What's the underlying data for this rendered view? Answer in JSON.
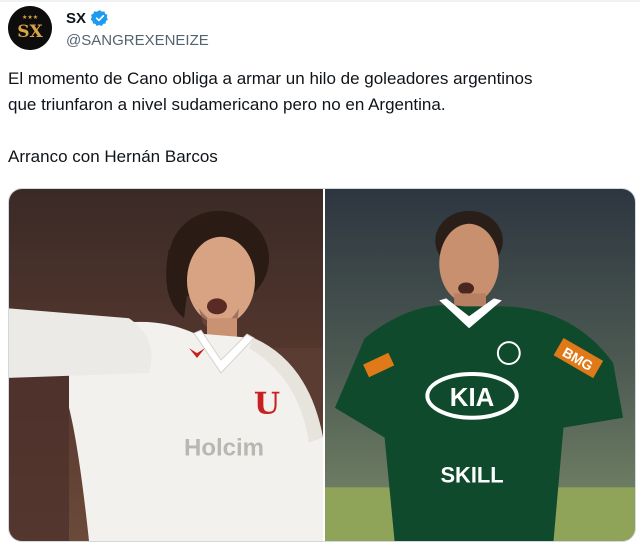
{
  "author": {
    "name": "SX",
    "handle": "@SANGREXENEIZE",
    "avatar_text": "SX",
    "avatar_stars": "★★★"
  },
  "tweet": {
    "line1": "El momento de Cano obliga a armar un hilo de goleadores argentinos",
    "line2": "que triunfaron a nivel sudamericano pero no en Argentina.",
    "line3": "Arranco con Hernán Barcos"
  },
  "media": {
    "left_photo": {
      "shirt_crest": "U",
      "sponsor": "Holcim"
    },
    "right_photo": {
      "sponsor_main": "KIA",
      "sponsor_lower": "SKILL",
      "sleeve_sponsor": "BMG"
    }
  },
  "colors": {
    "verified": "#1d9bf0",
    "handle": "#536471",
    "text": "#0f1419",
    "avatar_gold": "#d9a441",
    "palmeiras_green": "#0f4a2c",
    "ldu_white": "#f2f1ee",
    "ldu_red": "#c8201f"
  },
  "icons": {
    "verified": "verified-badge-icon"
  }
}
